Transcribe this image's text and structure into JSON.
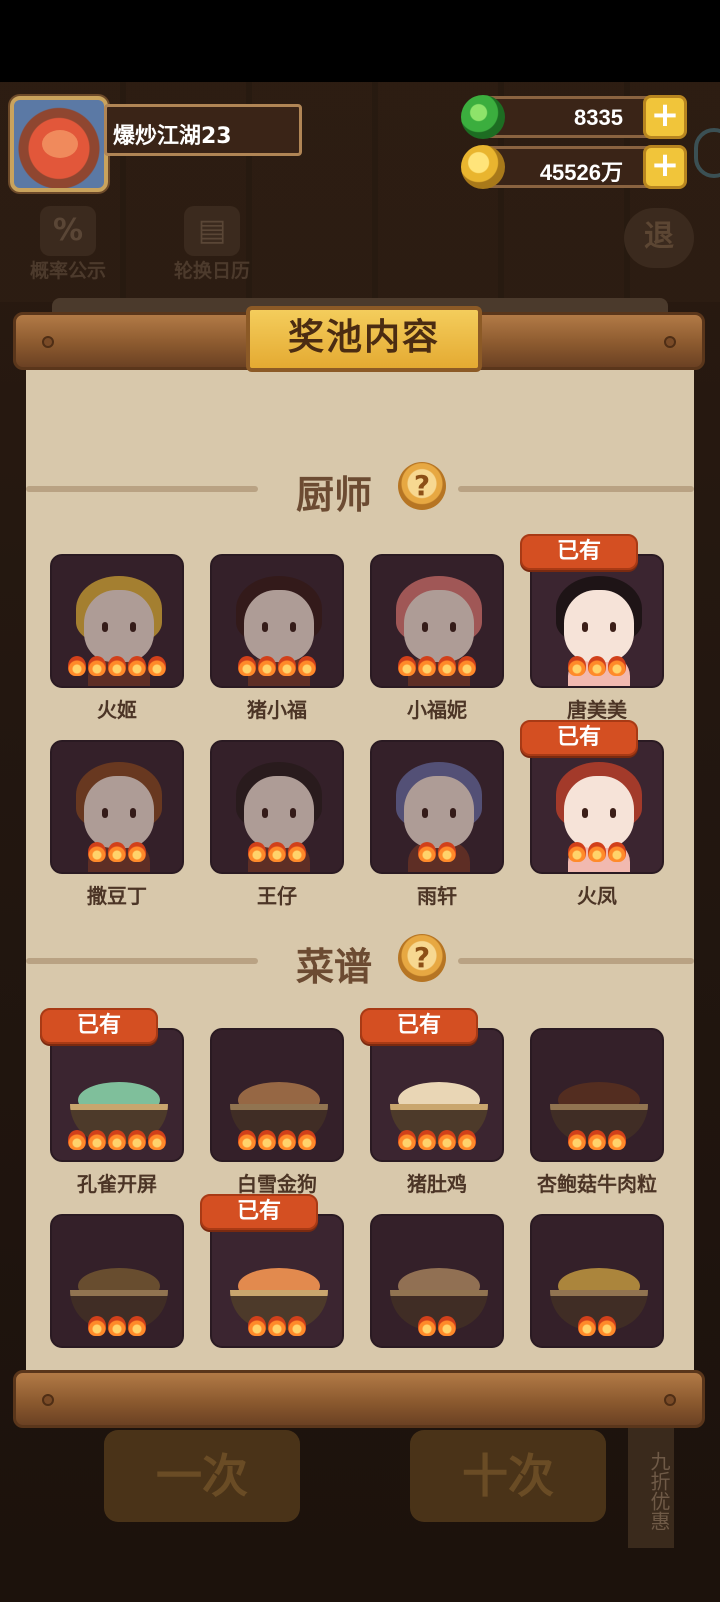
{
  "player": {
    "name": "爆炒江湖23"
  },
  "currencies": [
    {
      "icon": "jade-icon",
      "value": "8335"
    },
    {
      "icon": "coin-icon",
      "value": "45526万"
    }
  ],
  "toolbar": {
    "probability_label": "概率公示",
    "calendar_label": "轮换日历",
    "probability_icon": "%",
    "exit_label": "退"
  },
  "bottom": {
    "single_draw": "一次",
    "ten_draw": "十次",
    "discount": "九折优惠"
  },
  "dialog": {
    "title": "奖池内容",
    "owned_label": "已有",
    "chefs_section": "厨师",
    "recipes_section": "菜谱",
    "help_symbol": "?"
  },
  "chefs": [
    {
      "name": "火姬",
      "stars": 5,
      "owned": false,
      "hair": "#e6b73b"
    },
    {
      "name": "猪小福",
      "stars": 4,
      "owned": false,
      "hair": "#3a1d1a"
    },
    {
      "name": "小福妮",
      "stars": 4,
      "owned": false,
      "hair": "#e07a75"
    },
    {
      "name": "唐美美",
      "stars": 3,
      "owned": true,
      "hair": "#1e1416"
    },
    {
      "name": "撒豆丁",
      "stars": 3,
      "owned": false,
      "hair": "#8a4b22"
    },
    {
      "name": "王仔",
      "stars": 3,
      "owned": false,
      "hair": "#2a1e1e"
    },
    {
      "name": "雨轩",
      "stars": 2,
      "owned": false,
      "hair": "#6a6fa6"
    },
    {
      "name": "火凤",
      "stars": 3,
      "owned": true,
      "hair": "#a33a2a"
    }
  ],
  "recipes": [
    {
      "name": "孔雀开屏",
      "stars": 5,
      "owned": true,
      "color": "#7fbf9b"
    },
    {
      "name": "白雪金狗",
      "stars": 4,
      "owned": false,
      "color": "#d2935a"
    },
    {
      "name": "猪肚鸡",
      "stars": 4,
      "owned": true,
      "color": "#e9d6b5"
    },
    {
      "name": "杏鲍菇牛肉粒",
      "stars": 3,
      "owned": false,
      "color": "#6a3a22"
    },
    {
      "name": "",
      "stars": 3,
      "owned": false,
      "color": "#8a6a3a"
    },
    {
      "name": "",
      "stars": 3,
      "owned": true,
      "color": "#e28a4e"
    },
    {
      "name": "",
      "stars": 2,
      "owned": false,
      "color": "#c9a070"
    },
    {
      "name": "",
      "stars": 2,
      "owned": false,
      "color": "#f2c14e"
    }
  ]
}
